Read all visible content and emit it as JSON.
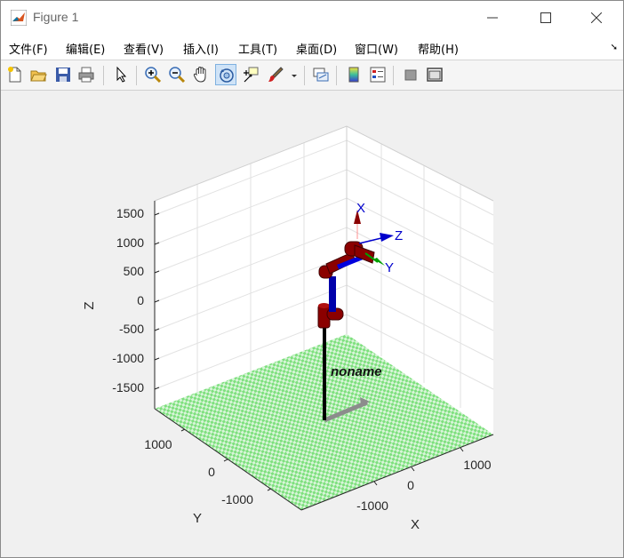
{
  "window": {
    "title": "Figure 1"
  },
  "menu": {
    "items": [
      "文件(F)",
      "编辑(E)",
      "查看(V)",
      "插入(I)",
      "工具(T)",
      "桌面(D)",
      "窗口(W)",
      "帮助(H)"
    ]
  },
  "toolbar": {
    "icons": [
      "new-figure-icon",
      "open-file-icon",
      "save-icon",
      "print-icon",
      "select-arrow-icon",
      "zoom-in-icon",
      "zoom-out-icon",
      "pan-hand-icon",
      "rotate-3d-icon",
      "data-cursor-icon",
      "brush-icon",
      "link-plot-icon",
      "colorbar-icon",
      "legend-icon",
      "hide-tools-icon",
      "dock-figure-icon"
    ],
    "active": "rotate-3d-icon"
  },
  "plot": {
    "z_ticks": [
      "1500",
      "1000",
      "500",
      "0",
      "-500",
      "-1000",
      "-1500"
    ],
    "y_ticks": [
      "1000",
      "0",
      "-1000"
    ],
    "x_ticks": [
      "1000",
      "0",
      "-1000"
    ],
    "z_label": "Z",
    "y_label": "Y",
    "x_label": "X",
    "robot_name": "noname",
    "frame_labels": {
      "x": "X",
      "y": "Y",
      "z": "Z"
    },
    "colors": {
      "floor": "#66e066",
      "link": "#8b0000",
      "joint_axis": "#0000cc",
      "x_axis": "#0000cc",
      "y_axis": "#00a000",
      "z_arrow": "#8b0000"
    }
  }
}
